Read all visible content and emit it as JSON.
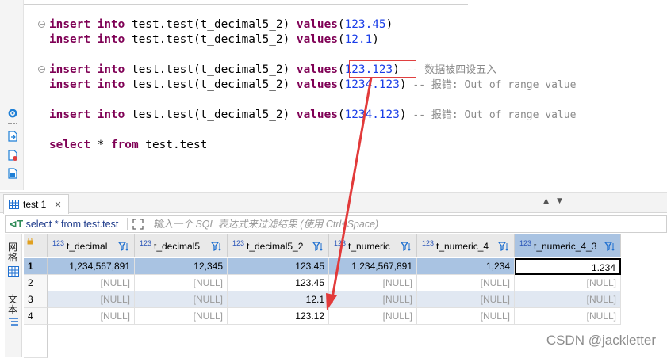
{
  "editor": {
    "lines": [
      {
        "id": "l1",
        "parts": [
          [
            "kw",
            "insert"
          ],
          [
            "id",
            " "
          ],
          [
            "kw",
            "into"
          ],
          [
            "id",
            " test.test(t_decimal5_2) "
          ],
          [
            "kw",
            "values"
          ],
          [
            "id",
            "("
          ],
          [
            "num",
            "123.45"
          ],
          [
            "id",
            ")"
          ]
        ]
      },
      {
        "id": "l2",
        "parts": [
          [
            "kw",
            "insert"
          ],
          [
            "id",
            " "
          ],
          [
            "kw",
            "into"
          ],
          [
            "id",
            " test.test(t_decimal5_2) "
          ],
          [
            "kw",
            "values"
          ],
          [
            "id",
            "("
          ],
          [
            "num",
            "12.1"
          ],
          [
            "id",
            ")"
          ]
        ]
      },
      {
        "id": "l3",
        "parts": [
          [
            "kw",
            "insert"
          ],
          [
            "id",
            " "
          ],
          [
            "kw",
            "into"
          ],
          [
            "id",
            " test.test(t_decimal5_2) "
          ],
          [
            "kw",
            "values"
          ],
          [
            "id",
            "("
          ],
          [
            "num",
            "123.123"
          ],
          [
            "id",
            ")"
          ],
          [
            "cm",
            " -- 数据被四设五入"
          ]
        ]
      },
      {
        "id": "l4",
        "parts": [
          [
            "kw",
            "insert"
          ],
          [
            "id",
            " "
          ],
          [
            "kw",
            "into"
          ],
          [
            "id",
            " test.test(t_decimal5_2) "
          ],
          [
            "kw",
            "values"
          ],
          [
            "id",
            "("
          ],
          [
            "num",
            "1234.123"
          ],
          [
            "id",
            ")"
          ],
          [
            "cm",
            " -- 报错: Out of range value"
          ]
        ]
      },
      {
        "id": "l5",
        "parts": [
          [
            "kw",
            "insert"
          ],
          [
            "id",
            " "
          ],
          [
            "kw",
            "into"
          ],
          [
            "id",
            " test.test(t_decimal5_2) "
          ],
          [
            "kw",
            "values"
          ],
          [
            "id",
            "("
          ],
          [
            "num",
            "1234.123"
          ],
          [
            "id",
            ")"
          ],
          [
            "cm",
            " -- 报错: Out of range value"
          ]
        ]
      },
      {
        "id": "l6",
        "parts": [
          [
            "kw",
            "select"
          ],
          [
            "id",
            " * "
          ],
          [
            "kw",
            "from"
          ],
          [
            "id",
            " test.test"
          ]
        ]
      }
    ]
  },
  "result_tab": {
    "label": "test 1",
    "close": "✕"
  },
  "filter": {
    "sql_prefix": "⊲T",
    "sql_text": " select * from test.test",
    "placeholder": "输入一个 SQL 表达式来过滤结果 (使用 Ctrl+Space)"
  },
  "side": {
    "grid_label": "网格",
    "text_label": "文本"
  },
  "grid": {
    "type_badge": "123",
    "columns": [
      "t_decimal",
      "t_decimal5",
      "t_decimal5_2",
      "t_numeric",
      "t_numeric_4",
      "t_numeric_4_3"
    ],
    "rows": [
      {
        "num": "1",
        "cells": [
          "1,234,567,891",
          "12,345",
          "123.45",
          "1,234,567,891",
          "1,234",
          "1.234"
        ]
      },
      {
        "num": "2",
        "cells": [
          "[NULL]",
          "[NULL]",
          "123.45",
          "[NULL]",
          "[NULL]",
          "[NULL]"
        ]
      },
      {
        "num": "3",
        "cells": [
          "[NULL]",
          "[NULL]",
          "12.1",
          "[NULL]",
          "[NULL]",
          "[NULL]"
        ]
      },
      {
        "num": "4",
        "cells": [
          "[NULL]",
          "[NULL]",
          "123.12",
          "[NULL]",
          "[NULL]",
          "[NULL]"
        ]
      }
    ]
  },
  "watermark": "CSDN @jackletter",
  "colors": {
    "keyword": "#7f0055",
    "number": "#1a3ee8",
    "comment": "#8a8a8a",
    "selection": "#a9c3e2",
    "annotation": "#e04040"
  }
}
